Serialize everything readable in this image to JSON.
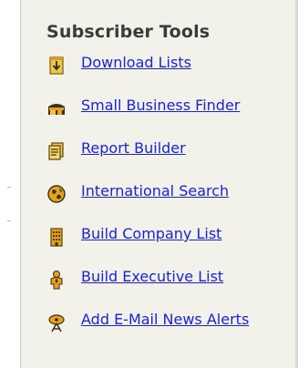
{
  "panel": {
    "title": "Subscriber Tools"
  },
  "tools": [
    {
      "label": "Download Lists",
      "icon": "download-icon"
    },
    {
      "label": "Small Business Finder",
      "icon": "storefront-icon"
    },
    {
      "label": "Report Builder",
      "icon": "report-icon"
    },
    {
      "label": "International Search",
      "icon": "globe-icon"
    },
    {
      "label": "Build Company List",
      "icon": "building-icon"
    },
    {
      "label": "Build Executive List",
      "icon": "executive-icon"
    },
    {
      "label": "Add E-Mail News Alerts",
      "icon": "satellite-dish-icon"
    }
  ],
  "colors": {
    "panel_background": "#f2f2ea",
    "link": "#1a23d6",
    "title": "#3a3a3a",
    "icon_gold": "#d9a01c"
  }
}
